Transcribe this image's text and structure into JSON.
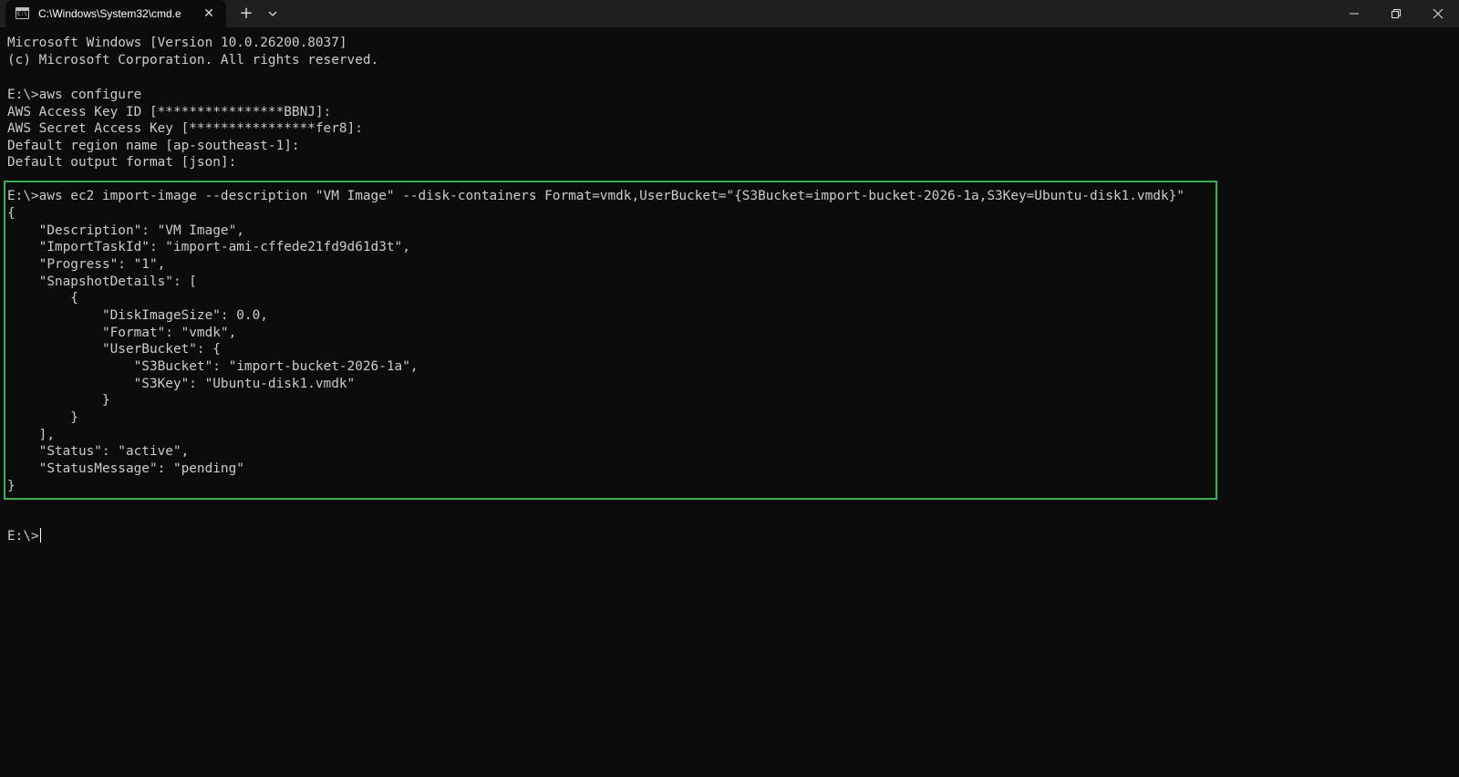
{
  "window": {
    "tab_title": "C:\\Windows\\System32\\cmd.e",
    "tab_icon_text": "C:\\."
  },
  "icons": {
    "close_tab": "close-icon",
    "new_tab": "plus-icon",
    "dropdown": "chevron-down-icon",
    "minimize": "minimize-icon",
    "maximize": "restore-icon",
    "close_window": "close-icon"
  },
  "colors": {
    "background": "#0c0c0c",
    "titlebar": "#1f1f1f",
    "text": "#cccccc",
    "highlight": "#2fb455"
  },
  "terminal": {
    "header": [
      "Microsoft Windows [Version 10.0.26200.8037]",
      "(c) Microsoft Corporation. All rights reserved."
    ],
    "configure": [
      "E:\\>aws configure",
      "AWS Access Key ID [****************BBNJ]:",
      "AWS Secret Access Key [****************fer8]:",
      "Default region name [ap-southeast-1]:",
      "Default output format [json]:"
    ],
    "import": [
      "E:\\>aws ec2 import-image --description \"VM Image\" --disk-containers Format=vmdk,UserBucket=\"{S3Bucket=import-bucket-2026-1a,S3Key=Ubuntu-disk1.vmdk}\"",
      "{",
      "    \"Description\": \"VM Image\",",
      "    \"ImportTaskId\": \"import-ami-cffede21fd9d61d3t\",",
      "    \"Progress\": \"1\",",
      "    \"SnapshotDetails\": [",
      "        {",
      "            \"DiskImageSize\": 0.0,",
      "            \"Format\": \"vmdk\",",
      "            \"UserBucket\": {",
      "                \"S3Bucket\": \"import-bucket-2026-1a\",",
      "                \"S3Key\": \"Ubuntu-disk1.vmdk\"",
      "            }",
      "        }",
      "    ],",
      "    \"Status\": \"active\",",
      "    \"StatusMessage\": \"pending\"",
      "}"
    ],
    "prompt": "E:\\>"
  }
}
